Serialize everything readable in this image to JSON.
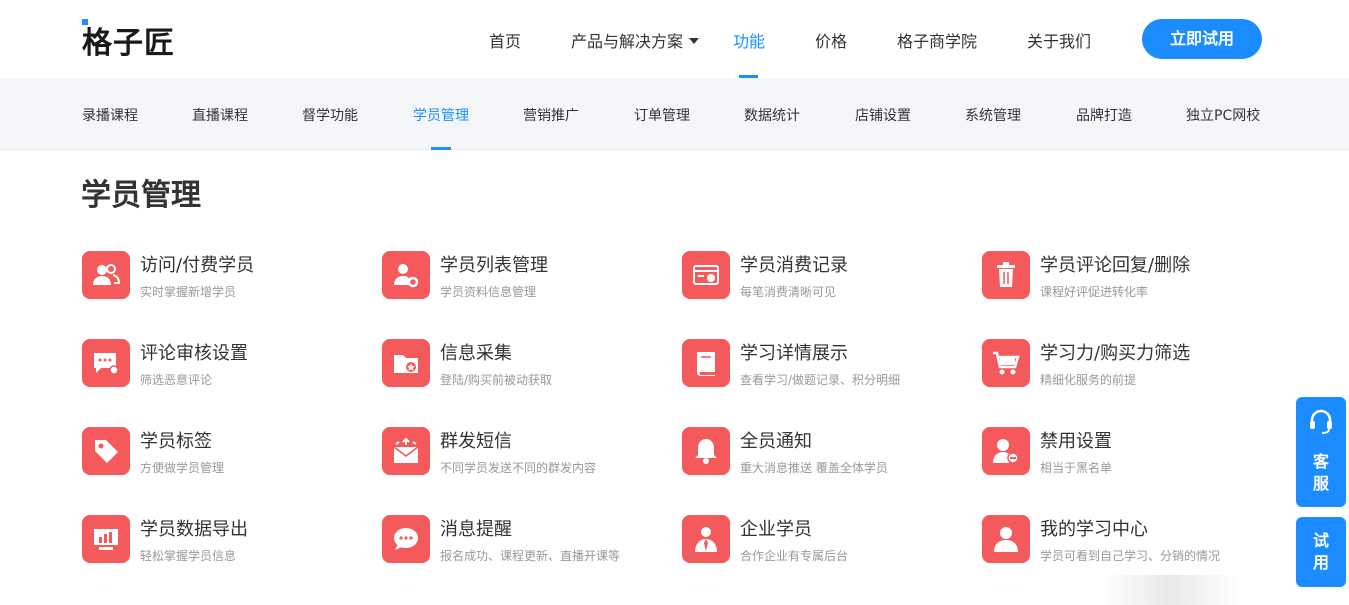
{
  "header": {
    "logo_text": "格子匠",
    "nav": [
      {
        "label": "首页"
      },
      {
        "label": "产品与解决方案"
      },
      {
        "label": "功能"
      },
      {
        "label": "价格"
      },
      {
        "label": "格子商学院"
      },
      {
        "label": "关于我们"
      }
    ],
    "cta_label": "立即试用",
    "accent_color": "#1890ff"
  },
  "subnav": [
    {
      "label": "录播课程"
    },
    {
      "label": "直播课程"
    },
    {
      "label": "督学功能"
    },
    {
      "label": "学员管理"
    },
    {
      "label": "营销推广"
    },
    {
      "label": "订单管理"
    },
    {
      "label": "数据统计"
    },
    {
      "label": "店铺设置"
    },
    {
      "label": "系统管理"
    },
    {
      "label": "品牌打造"
    },
    {
      "label": "独立PC网校"
    }
  ],
  "main": {
    "title": "学员管理",
    "icon_color": "#f4595b",
    "features": [
      {
        "title": "访问/付费学员",
        "desc": "实时掌握新增学员",
        "icon": "users-icon"
      },
      {
        "title": "学员列表管理",
        "desc": "学员资料信息管理",
        "icon": "user-gear-icon"
      },
      {
        "title": "学员消费记录",
        "desc": "每笔消费清晰可见",
        "icon": "receipt-icon"
      },
      {
        "title": "学员评论回复/删除",
        "desc": "课程好评促进转化率",
        "icon": "trash-icon"
      },
      {
        "title": "评论审核设置",
        "desc": "筛选恶意评论",
        "icon": "comment-gear-icon"
      },
      {
        "title": "信息采集",
        "desc": "登陆/购买前被动获取",
        "icon": "folder-star-icon"
      },
      {
        "title": "学习详情展示",
        "desc": "查看学习/做题记录、积分明细",
        "icon": "book-icon"
      },
      {
        "title": "学习力/购买力筛选",
        "desc": "精细化服务的前提",
        "icon": "cart-icon"
      },
      {
        "title": "学员标签",
        "desc": "方便做学员管理",
        "icon": "tag-icon"
      },
      {
        "title": "群发短信",
        "desc": "不同学员发送不同的群发内容",
        "icon": "envelope-icon"
      },
      {
        "title": "全员通知",
        "desc": "重大消息推送 覆盖全体学员",
        "icon": "bell-icon"
      },
      {
        "title": "禁用设置",
        "desc": "相当于黑名单",
        "icon": "user-block-icon"
      },
      {
        "title": "学员数据导出",
        "desc": "轻松掌握学员信息",
        "icon": "chart-monitor-icon"
      },
      {
        "title": "消息提醒",
        "desc": "报名成功、课程更新、直播开课等",
        "icon": "chat-bubbles-icon"
      },
      {
        "title": "企业学员",
        "desc": "合作企业有专属后台",
        "icon": "business-user-icon"
      },
      {
        "title": "我的学习中心",
        "desc": "学员可看到自己学习、分销的情况",
        "icon": "user-icon"
      }
    ]
  },
  "float": {
    "service_label_1": "客",
    "service_label_2": "服",
    "trial_label_1": "试",
    "trial_label_2": "用"
  }
}
